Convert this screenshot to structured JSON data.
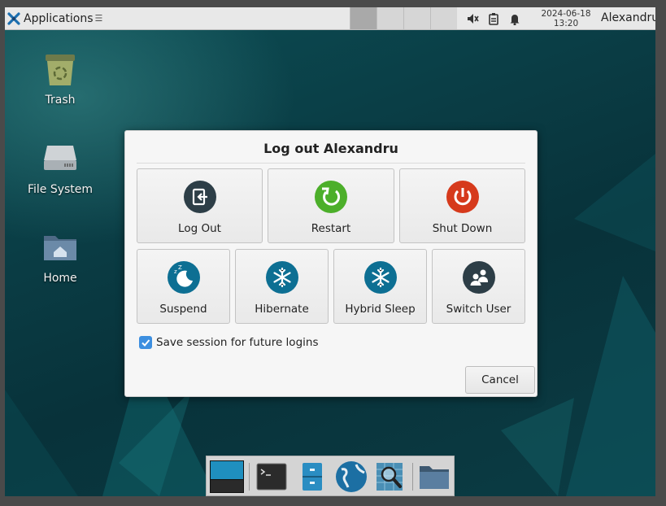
{
  "panel": {
    "applications_label": "Applications",
    "applications_glyph": "☰",
    "clock_date": "2024-06-18",
    "clock_time": "13:20",
    "user_name": "Alexandru",
    "tray_icons": [
      "mute-icon",
      "clipboard-icon",
      "notification-bell-icon"
    ]
  },
  "desktop": {
    "icons": [
      {
        "label": "Trash",
        "icon": "trash-icon"
      },
      {
        "label": "File System",
        "icon": "drive-icon"
      },
      {
        "label": "Home",
        "icon": "home-folder-icon"
      }
    ]
  },
  "dialog": {
    "title": "Log out Alexandru",
    "buttons_row1": [
      {
        "label": "Log Out",
        "icon": "logout-icon"
      },
      {
        "label": "Restart",
        "icon": "restart-icon"
      },
      {
        "label": "Shut Down",
        "icon": "power-icon"
      }
    ],
    "buttons_row2": [
      {
        "label": "Suspend",
        "icon": "suspend-icon"
      },
      {
        "label": "Hibernate",
        "icon": "snowflake-icon"
      },
      {
        "label": "Hybrid Sleep",
        "icon": "snowflake-icon"
      },
      {
        "label": "Switch User",
        "icon": "users-icon"
      }
    ],
    "save_session_label": "Save session for future logins",
    "save_session_checked": true,
    "cancel_label": "Cancel"
  },
  "dock": {
    "items": [
      "show-desktop-icon",
      "terminal-icon",
      "file-cabinet-icon",
      "web-browser-icon",
      "search-icon",
      "folder-icon"
    ]
  },
  "colors": {
    "logout": "#2d3e47",
    "restart": "#4caf2a",
    "shutdown": "#d63a1c",
    "sleep": "#0d6f93",
    "switch_user": "#2d3e47",
    "checkbox": "#3d8fe0"
  }
}
